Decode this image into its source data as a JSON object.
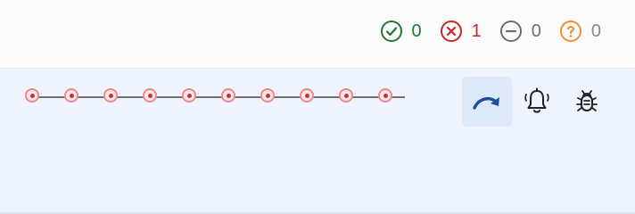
{
  "status_counters": {
    "passed": {
      "count": "0",
      "color": "#1f7a2e",
      "icon": "check-circle-icon"
    },
    "failed": {
      "count": "1",
      "color": "#c62828",
      "icon": "x-circle-icon"
    },
    "skipped": {
      "count": "0",
      "color": "#6e6e6e",
      "icon": "minus-circle-icon"
    },
    "unknown": {
      "count": "0",
      "color": "#f28c38",
      "icon": "question-circle-icon"
    }
  },
  "timeline": {
    "steps": [
      {
        "status": "failed"
      },
      {
        "status": "failed"
      },
      {
        "status": "failed"
      },
      {
        "status": "failed"
      },
      {
        "status": "failed"
      },
      {
        "status": "failed"
      },
      {
        "status": "failed"
      },
      {
        "status": "failed"
      },
      {
        "status": "failed"
      },
      {
        "status": "failed"
      }
    ],
    "node_color": "#ee8a8a",
    "dot_color": "#d32f2f"
  },
  "toolbar": {
    "redo": {
      "icon": "redo-arrow-icon",
      "active": true
    },
    "alerts": {
      "icon": "bell-icon"
    },
    "debug": {
      "icon": "bug-icon"
    }
  }
}
